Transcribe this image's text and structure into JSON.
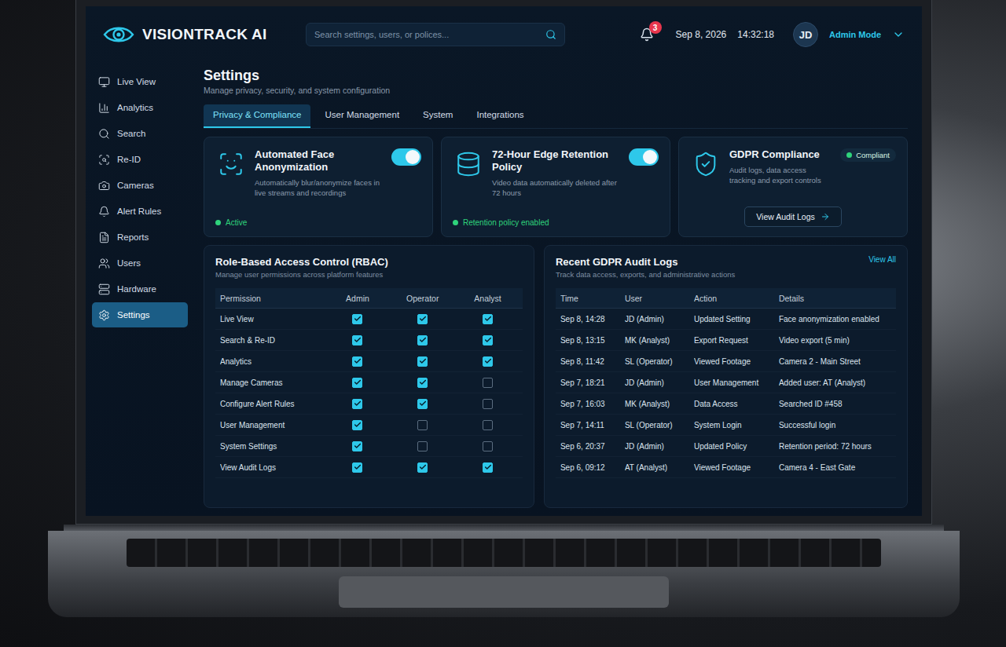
{
  "logo": {
    "text": "VISIONTRACK AI"
  },
  "search": {
    "placeholder": "Search settings, users, or polices..."
  },
  "notifications": {
    "count": "3"
  },
  "clock": {
    "date": "Sep 8, 2026",
    "time": "14:32:18"
  },
  "user": {
    "initials": "JD",
    "mode": "Admin Mode"
  },
  "sidebar": {
    "items": [
      {
        "label": "Live View",
        "selected": false
      },
      {
        "label": "Analytics",
        "selected": false
      },
      {
        "label": "Search",
        "selected": false
      },
      {
        "label": "Re-ID",
        "selected": false
      },
      {
        "label": "Cameras",
        "selected": false
      },
      {
        "label": "Alert Rules",
        "selected": false
      },
      {
        "label": "Reports",
        "selected": false
      },
      {
        "label": "Users",
        "selected": false
      },
      {
        "label": "Hardware",
        "selected": false
      },
      {
        "label": "Settings",
        "selected": true
      }
    ]
  },
  "page": {
    "title": "Settings",
    "subtitle": "Manage privacy, security, and system configuration"
  },
  "tabs": [
    {
      "label": "Privacy & Compliance",
      "selected": true
    },
    {
      "label": "User Management",
      "selected": false
    },
    {
      "label": "System",
      "selected": false
    },
    {
      "label": "Integrations",
      "selected": false
    }
  ],
  "cards": [
    {
      "kind": "toggle",
      "title": "Automated Face Anonymization",
      "description": "Automatically blur/anonymize faces in live streams and recordings",
      "on": true,
      "status": "Active"
    },
    {
      "kind": "toggle",
      "title": "72-Hour Edge Retention Policy",
      "description": "Video data automatically deleted after 72 hours",
      "on": true,
      "status": "Retention policy enabled"
    },
    {
      "kind": "compliance",
      "title": "GDPR Compliance",
      "badge": "Compliant",
      "description": "Audit logs, data access tracking and export controls",
      "button": "View Audit Logs"
    }
  ],
  "rbac": {
    "title": "Role-Based Access Control (RBAC)",
    "subtitle": "Manage user permissions across platform features",
    "columns": [
      "Permission",
      "Admin",
      "Operator",
      "Analyst"
    ],
    "rows": [
      {
        "permission": "Live View",
        "checks": [
          true,
          true,
          true
        ]
      },
      {
        "permission": "Search & Re-ID",
        "checks": [
          true,
          true,
          true
        ]
      },
      {
        "permission": "Analytics",
        "checks": [
          true,
          true,
          true
        ]
      },
      {
        "permission": "Manage Cameras",
        "checks": [
          true,
          true,
          false
        ]
      },
      {
        "permission": "Configure Alert Rules",
        "checks": [
          true,
          true,
          false
        ]
      },
      {
        "permission": "User Management",
        "checks": [
          true,
          false,
          false
        ]
      },
      {
        "permission": "System Settings",
        "checks": [
          true,
          false,
          false
        ]
      },
      {
        "permission": "View Audit Logs",
        "checks": [
          true,
          true,
          true
        ]
      }
    ]
  },
  "audit": {
    "title": "Recent GDPR Audit Logs",
    "subtitle": "Track data access, exports, and administrative actions",
    "link": "View All",
    "columns": [
      "Time",
      "User",
      "Action",
      "Details"
    ],
    "rows": [
      {
        "time": "Sep 8, 14:28",
        "user": "JD (Admin)",
        "action": "Updated Setting",
        "details": "Face anonymization enabled"
      },
      {
        "time": "Sep 8, 13:15",
        "user": "MK (Analyst)",
        "action": "Export Request",
        "details": "Video export (5 min)"
      },
      {
        "time": "Sep 8, 11:42",
        "user": "SL (Operator)",
        "action": "Viewed Footage",
        "details": "Camera 2 - Main Street"
      },
      {
        "time": "Sep 7, 18:21",
        "user": "JD (Admin)",
        "action": "User Management",
        "details": "Added user: AT (Analyst)"
      },
      {
        "time": "Sep 7, 16:03",
        "user": "MK (Analyst)",
        "action": "Data Access",
        "details": "Searched ID #458"
      },
      {
        "time": "Sep 7, 14:11",
        "user": "SL (Operator)",
        "action": "System Login",
        "details": "Successful login"
      },
      {
        "time": "Sep 6, 20:37",
        "user": "JD (Admin)",
        "action": "Updated Policy",
        "details": "Retention period: 72 hours"
      },
      {
        "time": "Sep 6, 09:12",
        "user": "AT (Analyst)",
        "action": "Viewed Footage",
        "details": "Camera 4 - East Gate"
      }
    ]
  }
}
